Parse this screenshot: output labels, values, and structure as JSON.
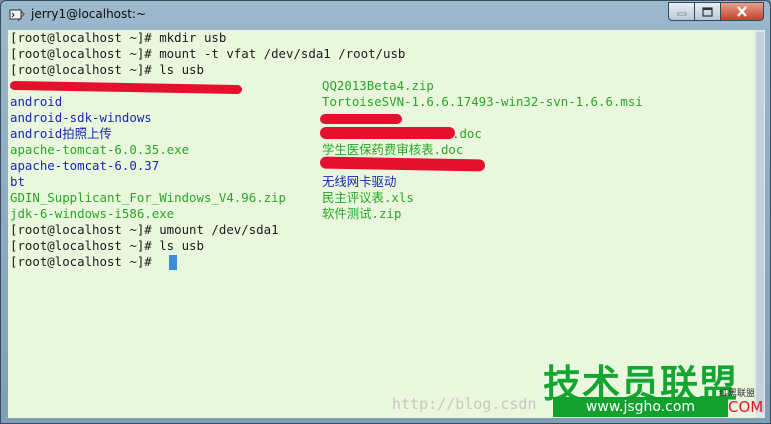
{
  "window": {
    "title": "jerry1@localhost:~",
    "icons": {
      "app": "terminal-icon",
      "minimize": "minimize-icon",
      "maximize": "maximize-icon",
      "close": "close-icon"
    }
  },
  "terminal": {
    "lines": [
      "[root@localhost ~]# mkdir usb",
      "[root@localhost ~]# mount -t vfat /dev/sda1 /root/usb",
      "[root@localhost ~]# ls usb",
      "",
      "[root@localhost ~]# umount /dev/sda1",
      "[root@localhost ~]# ls usb",
      "[root@localhost ~]# "
    ],
    "ls_left": [
      {
        "text": "",
        "color": "green"
      },
      {
        "text": "android",
        "color": "blue"
      },
      {
        "text": "android-sdk-windows",
        "color": "blue"
      },
      {
        "text": "android拍照上传",
        "color": "blue"
      },
      {
        "text": "apache-tomcat-6.0.35.exe",
        "color": "green"
      },
      {
        "text": "apache-tomcat-6.0.37",
        "color": "blue"
      },
      {
        "text": "bt",
        "color": "blue"
      },
      {
        "text": "GDIN_Supplicant_For_Windows_V4.96.zip",
        "color": "green"
      },
      {
        "text": "jdk-6-windows-i586.exe",
        "color": "green"
      }
    ],
    "ls_right": [
      {
        "text": "QQ2013Beta4.zip",
        "color": "green"
      },
      {
        "text": "TortoiseSVN-1.6.6.17493-win32-svn-1.6.6.msi",
        "color": "green"
      },
      {
        "text": "",
        "color": "green"
      },
      {
        "text": ".doc",
        "color": "green"
      },
      {
        "text": "学生医保药费审核表.doc",
        "color": "green"
      },
      {
        "text": "",
        "color": "green"
      },
      {
        "text": "无线网卡驱动",
        "color": "blue"
      },
      {
        "text": "民主评议表.xls",
        "color": "green"
      },
      {
        "text": "软件测试.zip",
        "color": "green"
      }
    ],
    "colors": {
      "background": "#e9f8dd",
      "prompt": "#1b1b1b",
      "file_green": "#2aa52a",
      "dir_blue": "#1a26b0",
      "cursor": "#3a8ed8",
      "redaction": "#e5102e"
    }
  },
  "watermark": {
    "url": "http://blog.csdn",
    "logo_text": "技术员联盟",
    "logo_small": "红黑联盟",
    "logo_url": "www.jsgho.com",
    "logo_com": "COM"
  }
}
